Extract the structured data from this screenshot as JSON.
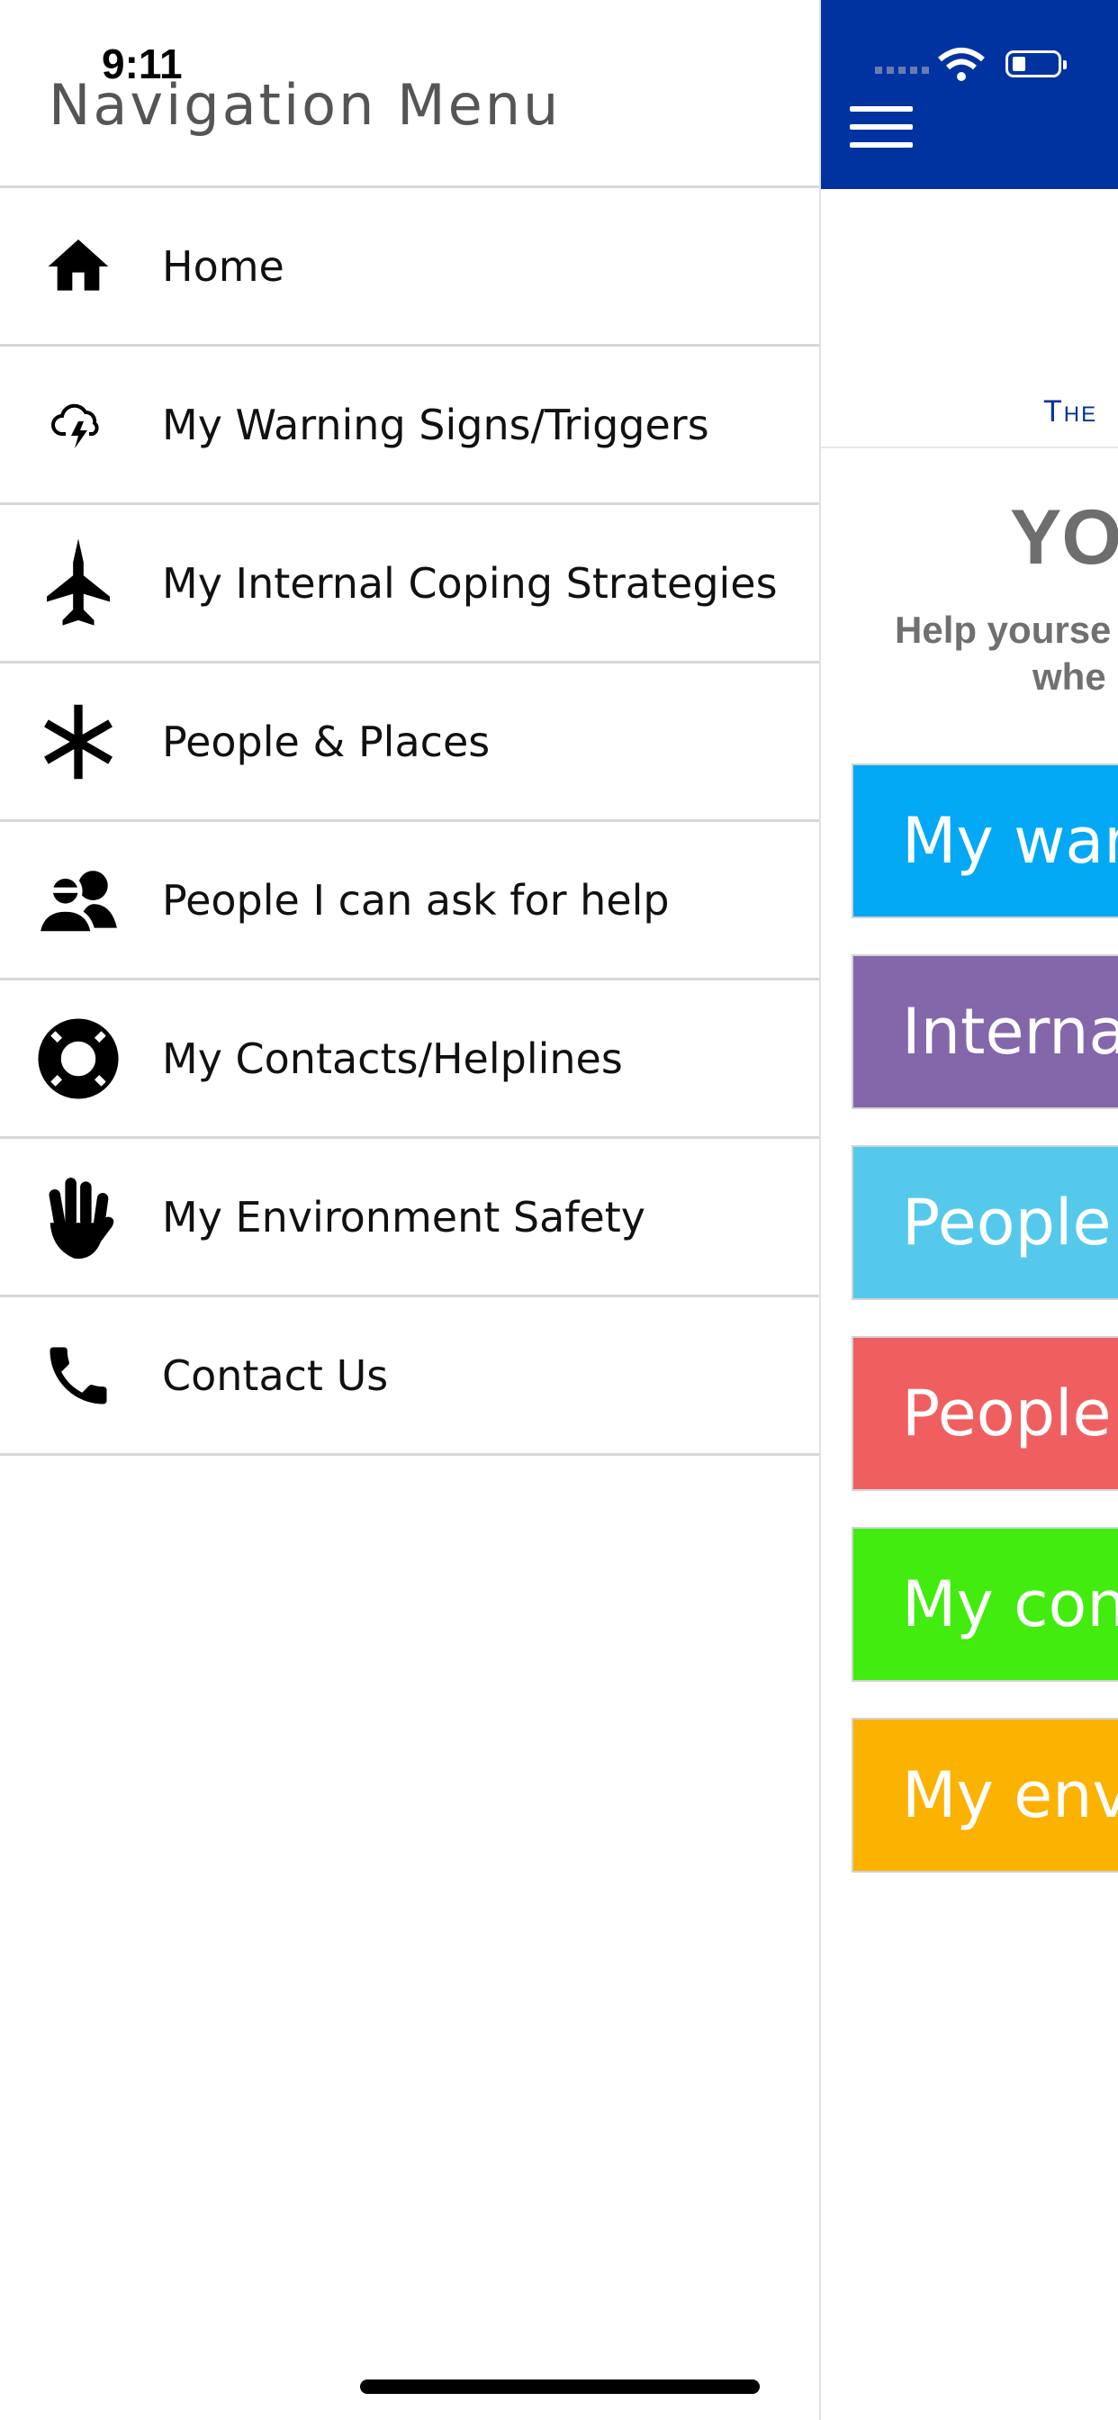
{
  "status_bar": {
    "time": "9:11"
  },
  "drawer": {
    "title": "Navigation Menu",
    "items": [
      {
        "label": "Home",
        "icon": "home-icon"
      },
      {
        "label": "My Warning Signs/Triggers",
        "icon": "storm-cloud-icon"
      },
      {
        "label": "My Internal Coping Strategies",
        "icon": "jet-icon"
      },
      {
        "label": "People & Places",
        "icon": "asterisk-icon"
      },
      {
        "label": "People I can ask for help",
        "icon": "people-icon"
      },
      {
        "label": "My Contacts/Helplines",
        "icon": "lifebuoy-icon"
      },
      {
        "label": "My Environment Safety",
        "icon": "hand-icon"
      },
      {
        "label": "Contact Us",
        "icon": "phone-icon"
      }
    ]
  },
  "app": {
    "header_color": "#0033a0",
    "brand_text": "The",
    "title": "YO",
    "subtitle_line1": "Help yourse",
    "subtitle_line2": "whe",
    "tiles": [
      {
        "label": "My warn",
        "color": "#03a9f4"
      },
      {
        "label": "Internal",
        "color": "#8466ab"
      },
      {
        "label": "People",
        "color": "#55c9ec"
      },
      {
        "label": "People",
        "color": "#f05f5f"
      },
      {
        "label": "My cont",
        "color": "#41ec0e"
      },
      {
        "label": "My envi",
        "color": "#fcb200"
      }
    ]
  }
}
